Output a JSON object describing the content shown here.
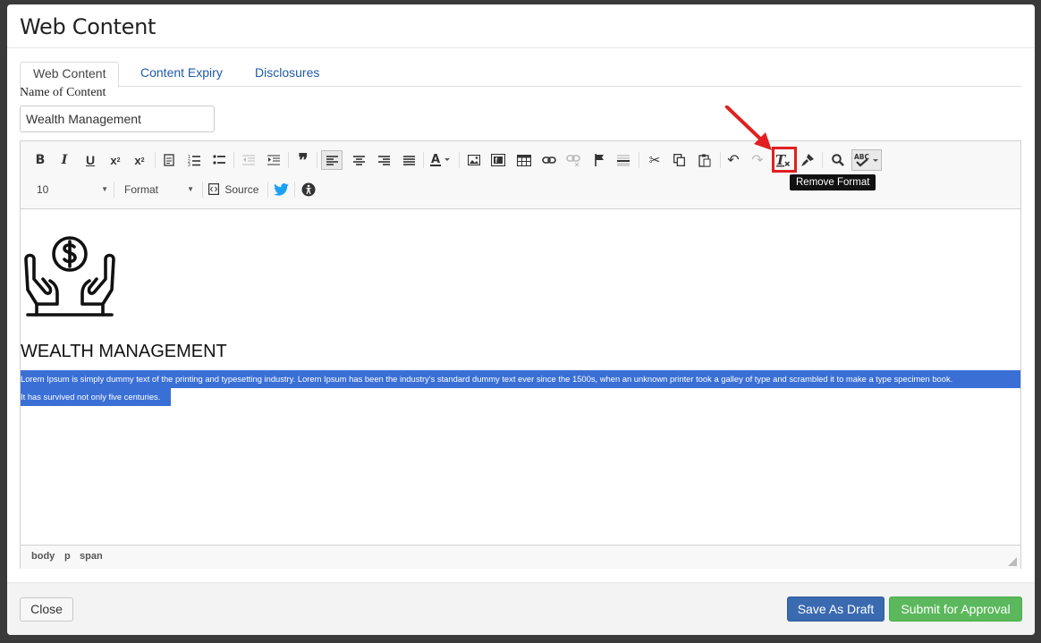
{
  "modal": {
    "title": "Web Content"
  },
  "tabs": [
    {
      "label": "Web Content",
      "active": true
    },
    {
      "label": "Content Expiry",
      "active": false
    },
    {
      "label": "Disclosures",
      "active": false
    }
  ],
  "form": {
    "name_label": "Name of Content",
    "name_value": "Wealth Management"
  },
  "toolbar": {
    "font_size": "10",
    "format": "Format",
    "source_label": "Source",
    "tooltip": "Remove Format",
    "highlighted_button": "remove-format",
    "buttons": [
      "bold-icon",
      "italic-icon",
      "underline-icon",
      "subscript-icon",
      "superscript-icon",
      "paste-text-icon",
      "numbered-list-icon",
      "bulleted-list-icon",
      "outdent-icon",
      "indent-icon",
      "blockquote-icon",
      "align-left-icon",
      "align-center-icon",
      "align-right-icon",
      "justify-icon",
      "text-color-icon",
      "image-icon",
      "flash-icon",
      "table-icon",
      "link-icon",
      "unlink-icon",
      "anchor-icon",
      "horizontal-rule-icon",
      "cut-icon",
      "copy-icon",
      "paste-icon",
      "undo-icon",
      "redo-icon",
      "remove-format-icon",
      "format-painter-icon",
      "find-icon",
      "spellcheck-icon",
      "twitter-icon",
      "accessibility-icon"
    ]
  },
  "editor": {
    "logo": "hands-money-icon",
    "heading": "WEALTH MANAGEMENT",
    "paragraph_line1": "Lorem Ipsum is simply dummy text of the printing and typesetting industry. Lorem Ipsum has been the industry's standard dummy text ever since the 1500s, when an unknown printer took a galley of type and scrambled it to make a type specimen book.",
    "paragraph_line2": "It has survived not only five centuries.",
    "selection_color": "#3a6fd6"
  },
  "path_bar": [
    "body",
    "p",
    "span"
  ],
  "footer": {
    "close": "Close",
    "save_draft": "Save As Draft",
    "submit": "Submit for Approval"
  },
  "colors": {
    "draft": "#3a6ab0",
    "submit": "#5cb85c",
    "highlight": "#e02020"
  }
}
